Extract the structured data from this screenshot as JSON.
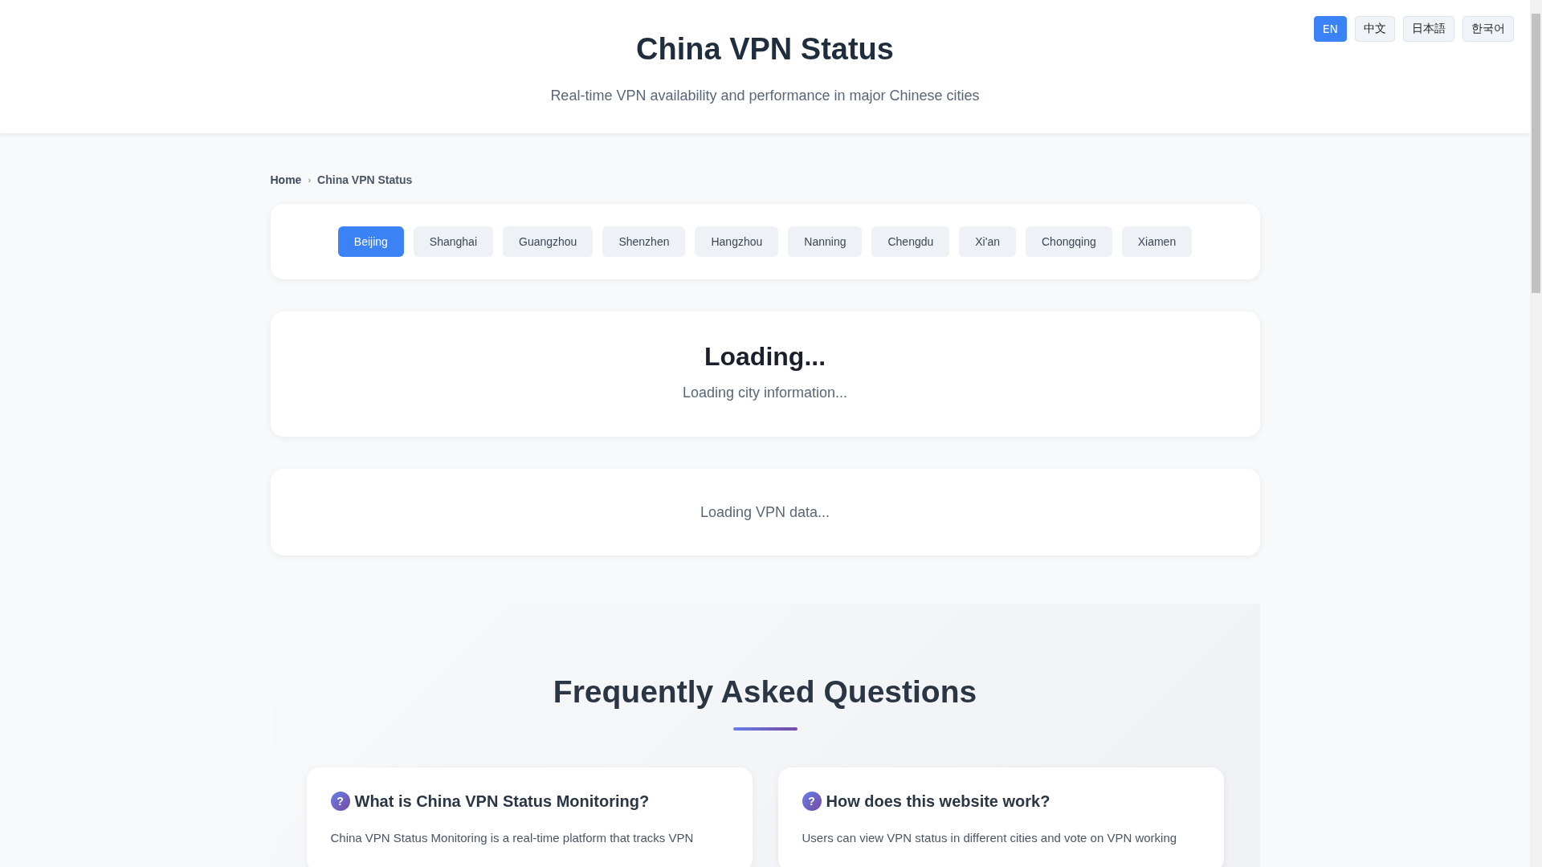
{
  "header": {
    "title": "China VPN Status",
    "subtitle": "Real-time VPN availability and performance in major Chinese cities"
  },
  "languages": [
    {
      "label": "EN",
      "selected": true
    },
    {
      "label": "中文",
      "selected": false
    },
    {
      "label": "日本語",
      "selected": false
    },
    {
      "label": "한국어",
      "selected": false
    }
  ],
  "breadcrumb": [
    {
      "label": "Home",
      "kind": "link"
    },
    {
      "label": "›",
      "kind": "separator"
    },
    {
      "label": "China VPN Status",
      "kind": "current"
    }
  ],
  "cities": [
    {
      "label": "Beijing",
      "selected": true
    },
    {
      "label": "Shanghai",
      "selected": false
    },
    {
      "label": "Guangzhou",
      "selected": false
    },
    {
      "label": "Shenzhen",
      "selected": false
    },
    {
      "label": "Hangzhou",
      "selected": false
    },
    {
      "label": "Nanning",
      "selected": false
    },
    {
      "label": "Chengdu",
      "selected": false
    },
    {
      "label": "Xi'an",
      "selected": false
    },
    {
      "label": "Chongqing",
      "selected": false
    },
    {
      "label": "Xiamen",
      "selected": false
    }
  ],
  "city_info": {
    "title": "Loading...",
    "text": "Loading city information..."
  },
  "vpn_data": {
    "text": "Loading VPN data..."
  },
  "faq": {
    "title": "Frequently Asked Questions",
    "items": [
      {
        "icon": "?",
        "question": "What is China VPN Status Monitoring?",
        "answer": "China VPN Status Monitoring is a real-time platform that tracks VPN"
      },
      {
        "icon": "?",
        "question": "How does this website work?",
        "answer": "Users can view VPN status in different cities and vote on VPN working"
      }
    ]
  }
}
